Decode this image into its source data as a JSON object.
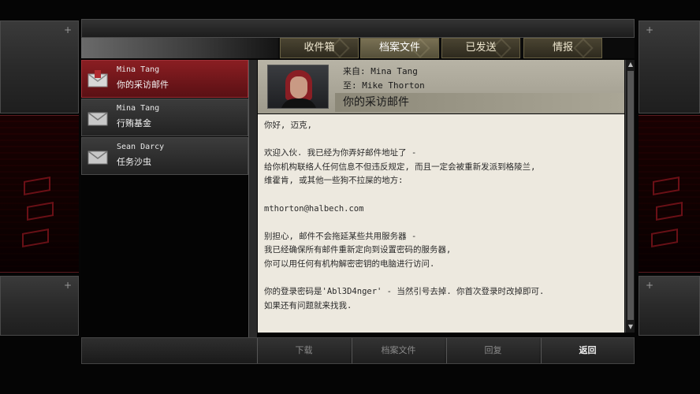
{
  "tabs": [
    {
      "label": "收件箱",
      "active": false
    },
    {
      "label": "档案文件",
      "active": true
    },
    {
      "label": "已发送",
      "active": false
    },
    {
      "label": "情报",
      "active": false
    }
  ],
  "messages": [
    {
      "from": "Mina Tang",
      "subject": "你的采访邮件",
      "selected": true,
      "icon": "envelope-icon"
    },
    {
      "from": "Mina Tang",
      "subject": "行贿基金",
      "selected": false,
      "icon": "envelope-icon"
    },
    {
      "from": "Sean Darcy",
      "subject": "任务沙虫",
      "selected": false,
      "icon": "envelope-icon"
    }
  ],
  "header": {
    "from_line": "来自:  Mina Tang",
    "to_line": "至:  Mike Thorton",
    "subject": "你的采访邮件"
  },
  "body": {
    "lines": [
      "你好, 迈克,",
      "",
      "欢迎入伙. 我已经为你弄好邮件地址了 -",
      "给你机构联络人任何信息不但违反规定, 而且一定会被重新发派到格陵兰,",
      "维霍肯, 或其他一些狗不拉屎的地方:",
      "",
      "mthorton@halbech.com",
      "",
      "别担心, 邮件不会拖延某些共用服务器 -",
      "我已经确保所有邮件重新定向到设置密码的服务器,",
      "你可以用任何有机构解密密钥的电脑进行访问.",
      "",
      "你的登录密码是'Abl3D4nger' - 当然引号去掉. 你首次登录时改掉即可.",
      "如果还有问题就来找我."
    ]
  },
  "buttons": [
    {
      "label": "下载",
      "enabled": false
    },
    {
      "label": "档案文件",
      "enabled": false
    },
    {
      "label": "回复",
      "enabled": false
    },
    {
      "label": "返回",
      "enabled": true
    }
  ],
  "side_plus": "+",
  "colors": {
    "selected_row": "#8a1e22",
    "active_tab": "#7a7154",
    "body_bg": "#ede9df"
  }
}
